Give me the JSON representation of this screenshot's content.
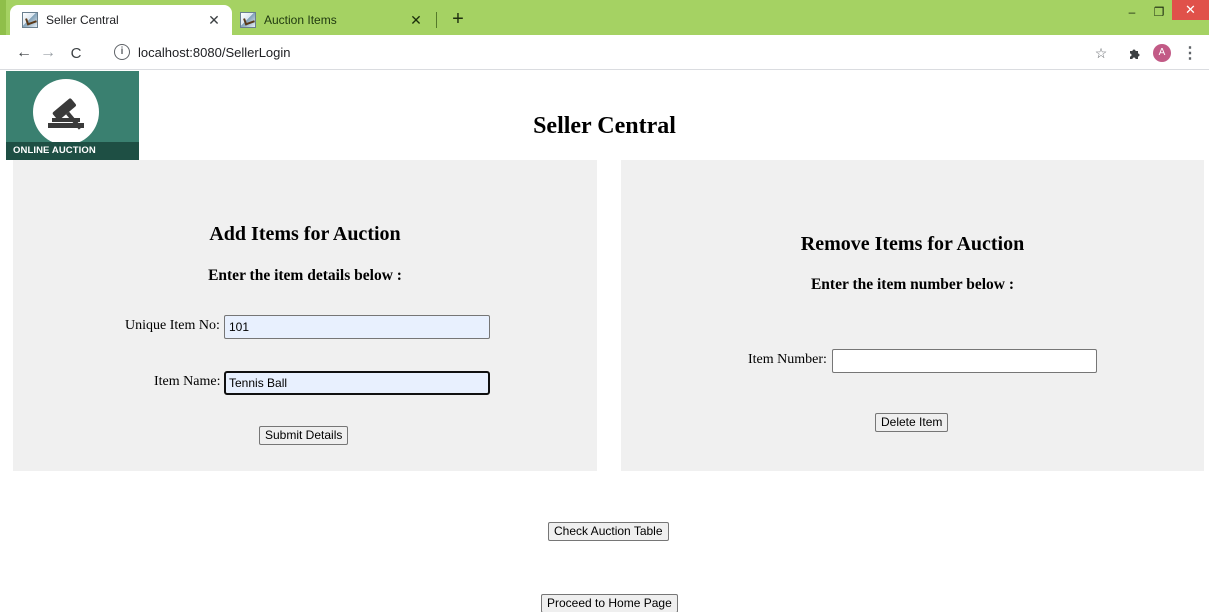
{
  "browser": {
    "tabs": [
      {
        "title": "Seller Central",
        "active": true
      },
      {
        "title": "Auction Items",
        "active": false
      }
    ],
    "url": "localhost:8080/SellerLogin",
    "profile_initial": "A",
    "accent_color": "#a5d263"
  },
  "header": {
    "logo_caption": "ONLINE AUCTION",
    "title": "Seller Central"
  },
  "add_panel": {
    "heading": "Add Items for Auction",
    "subheading": "Enter the item details below :",
    "item_no_label": "Unique Item No:",
    "item_no_value": "101",
    "item_name_label": "Item Name:",
    "item_name_value": "Tennis Ball",
    "submit_label": "Submit Details"
  },
  "remove_panel": {
    "heading": "Remove Items for Auction",
    "subheading": "Enter the item number below :",
    "item_number_label": "Item Number:",
    "item_number_value": "",
    "delete_label": "Delete Item"
  },
  "footer": {
    "check_table_label": "Check Auction Table",
    "home_label": "Proceed to Home Page"
  }
}
